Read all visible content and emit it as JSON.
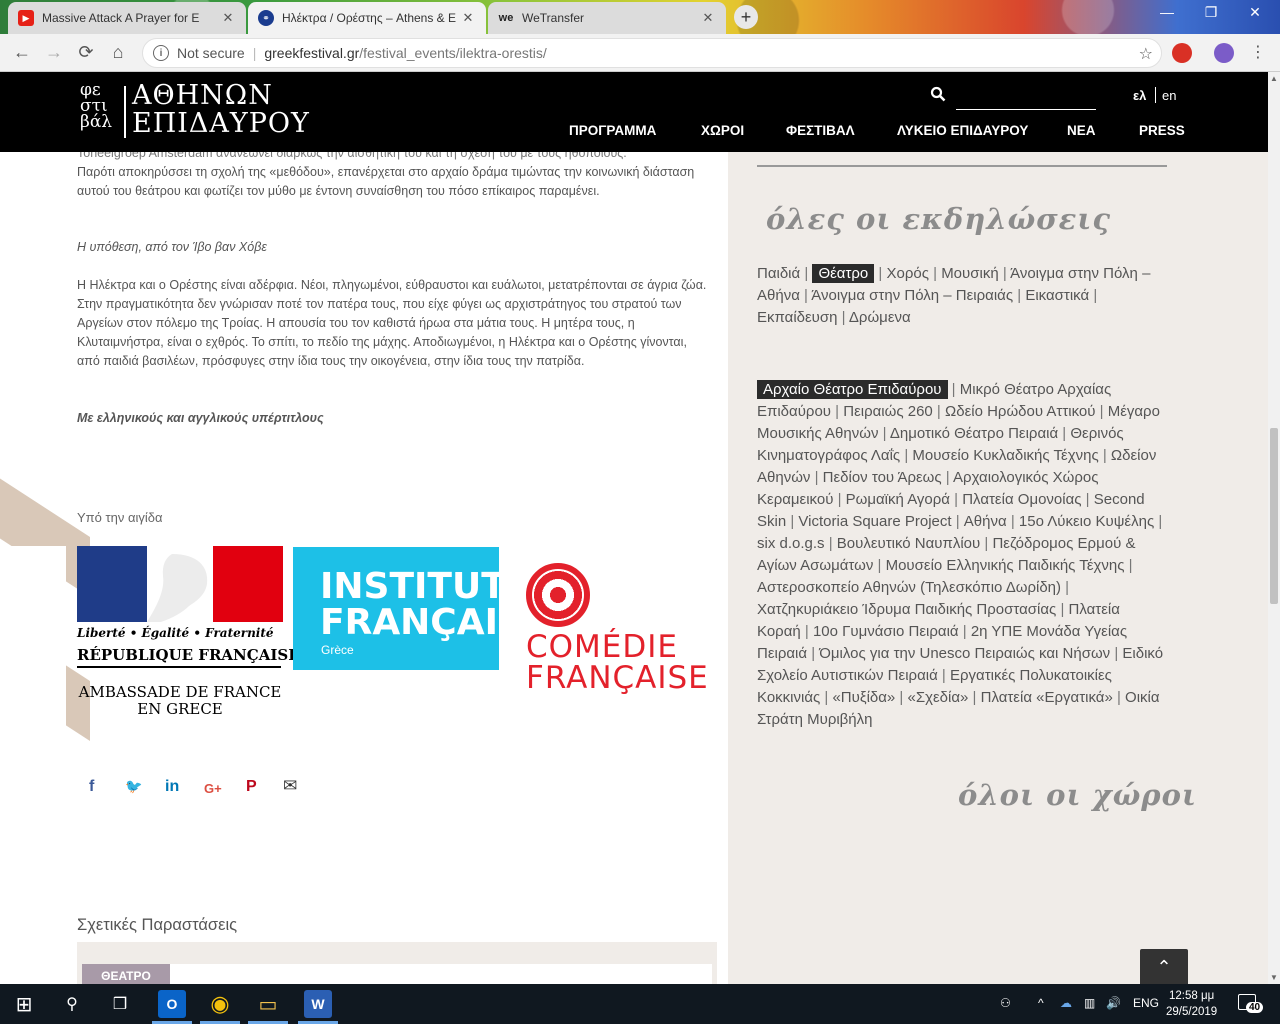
{
  "browser": {
    "tabs": [
      {
        "title": "Massive Attack A Prayer for E",
        "fav_color": "#e62117",
        "fav_glyph": "▶",
        "close": "✕"
      },
      {
        "title": "Ηλέκτρα / Ορέστης – Athens & E",
        "fav_color": "#1a3c8f",
        "fav_glyph": "⚭",
        "close": "✕"
      },
      {
        "title": "WeTransfer",
        "fav_color": "#222222",
        "fav_glyph": "we",
        "close": "✕"
      }
    ],
    "new_tab": "+",
    "window": {
      "minimize": "—",
      "restore": "❐",
      "close": "✕"
    },
    "nav": {
      "back": "←",
      "forward": "→",
      "reload": "⟳",
      "home": "⌂"
    },
    "address": {
      "security": "Not secure",
      "separator": "|",
      "domain": "greekfestival.gr",
      "path": "/festival_events/ilektra-orestis/"
    },
    "bookmark": "☆"
  },
  "header": {
    "logo_small": [
      "φε",
      "στι",
      "βάλ"
    ],
    "logo_big": [
      "ΑΘΗΝΩΝ",
      "ΕΠΙΔΑΥΡΟΥ"
    ],
    "search_icon": "🔍",
    "lang_el": "ελ",
    "lang_en": "en",
    "menu": [
      "ΠΡΟΓΡΑΜΜΑ",
      "ΧΩΡΟΙ",
      "ΦΕΣΤΙΒΑΛ",
      "ΛΥΚΕΙΟ ΕΠΙΔΑΥΡΟΥ",
      "ΝΕΑ",
      "PRESS"
    ]
  },
  "article": {
    "cut_line": "Toneelgroep Amsterdam ανανεώνει διαρκώς την αισθητική του και τη σχέση του με τους ηθοποιούς.",
    "para1": "Παρότι αποκηρύσσει τη σχολή της «μεθόδου», επανέρχεται στο αρχαίο δράμα τιμώντας την κοινωνική διάσταση αυτού του θεάτρου και φωτίζει τον μύθο με έντονη συναίσθηση του πόσο επίκαιρος παραμένει.",
    "plot_heading": "Η υπόθεση, από τον Ίβο βαν Χόβε",
    "para2": "Η Ηλέκτρα και ο Ορέστης είναι αδέρφια. Νέοι, πληγωμένοι, εύθραυστοι και ευάλωτοι, μετατρέπονται σε άγρια ζώα. Στην πραγματικότητα δεν γνώρισαν ποτέ τον πατέρα τους, που είχε φύγει ως αρχιστράτηγος του στρατού των Αργείων στον πόλεμο της Τροίας. Η απουσία του τον καθιστά ήρωα στα μάτια τους. Η μητέρα τους, η Κλυταιμνήστρα, είναι ο εχθρός. Το σπίτι, το πεδίο της μάχης. Αποδιωγμένοι, η Ηλέκτρα και ο Ορέστης γίνονται, από παιδιά βασιλέων, πρόσφυγες στην ίδια τους την οικογένεια, στην ίδια τους την πατρίδα.",
    "subtitles": "Με ελληνικούς και αγγλικούς υπέρτιτλους",
    "under_auspices": "Υπό την αιγίδα",
    "rf_motto": "Liberté • Égalité • Fraternité",
    "rf_name": "RÉPUBLIQUE FRANÇAISE",
    "rf_embassy_1": "AMBASSADE DE FRANCE",
    "rf_embassy_2": "EN GRECE",
    "if_line1": "INSTITUT",
    "if_line2": "FRANÇAIS",
    "if_line3": "Grèce",
    "cf_line1": "COMÉDIE",
    "cf_line2": "FRANÇAISE",
    "share": [
      {
        "name": "facebook-icon",
        "glyph": "f",
        "color": "#3b5998"
      },
      {
        "name": "twitter-icon",
        "glyph": "🐦",
        "color": "#55acee"
      },
      {
        "name": "linkedin-icon",
        "glyph": "in",
        "color": "#0077b5"
      },
      {
        "name": "google-plus-icon",
        "glyph": "G+",
        "color": "#dc4e41"
      },
      {
        "name": "pinterest-icon",
        "glyph": "P",
        "color": "#bd081c"
      },
      {
        "name": "email-icon",
        "glyph": "✉",
        "color": "#333333"
      }
    ],
    "related_title": "Σχετικές Παραστάσεις",
    "related_badge": "ΘΕΑΤΡΟ"
  },
  "sidebar": {
    "events_heading": "όλες οι εκδηλώσεις",
    "categories": [
      "Παιδιά",
      "Θέατρο",
      "Χορός",
      "Μουσική",
      "Άνοιγμα στην Πόλη – Αθήνα",
      "Άνοιγμα στην Πόλη – Πειραιάς",
      "Εικαστικά",
      "Εκπαίδευση",
      "Δρώμενα"
    ],
    "selected_category": "Θέατρο",
    "venues": [
      "Αρχαίο Θέατρο Επιδαύρου",
      "Μικρό Θέατρο Αρχαίας Επιδαύρου",
      "Πειραιώς 260",
      "Ωδείο Ηρώδου Αττικού",
      "Μέγαρο Μουσικής Αθηνών",
      "Δημοτικό Θέατρο Πειραιά",
      "Θερινός Κινηματογράφος Λαΐς",
      "Μουσείο Κυκλαδικής Τέχνης",
      "Ωδείον Αθηνών",
      "Πεδίον του Άρεως",
      "Αρχαιολογικός Χώρος Κεραμεικού",
      "Ρωμαϊκή Αγορά",
      "Πλατεία Ομονοίας",
      "Second Skin",
      "Victoria Square Project",
      "Αθήνα",
      "15ο Λύκειο Κυψέλης",
      "six d.o.g.s",
      "Βουλευτικό Ναυπλίου",
      "Πεζόδρομος Ερμού & Αγίων Ασωμάτων",
      "Μουσείο Ελληνικής Παιδικής Τέχνης",
      "Αστεροσκοπείο Αθηνών (Τηλεσκόπιο Δωρίδη)",
      "Χατζηκυριάκειο Ίδρυμα Παιδικής Προστασίας",
      "Πλατεία Κοραή",
      "10ο Γυμνάσιο Πειραιά",
      "2η ΥΠΕ Μονάδα Υγείας Πειραιά",
      "Όμιλος για την Unesco Πειραιώς και Νήσων",
      "Ειδικό Σχολείο Αυτιστικών Πειραιά",
      "Εργατικές Πολυκατοικίες Κοκκινιάς",
      "«Πυξίδα»",
      "«Σχεδία»",
      "Πλατεία «Εργατικά»",
      "Οικία Στράτη Μυριβήλη"
    ],
    "selected_venue": "Αρχαίο Θέατρο Επιδαύρου",
    "venues_heading": "όλοι οι χώροι",
    "to_top": "⌃"
  },
  "taskbar": {
    "icons": [
      {
        "name": "windows-start-icon",
        "glyph": "⊞"
      },
      {
        "name": "search-icon",
        "glyph": "⚲"
      },
      {
        "name": "task-view-icon",
        "glyph": "❒"
      },
      {
        "name": "outlook-icon",
        "glyph": "O"
      },
      {
        "name": "chrome-icon",
        "glyph": "◉"
      },
      {
        "name": "file-explorer-icon",
        "glyph": "▭"
      },
      {
        "name": "word-icon",
        "glyph": "W"
      }
    ],
    "tray": {
      "people": "⚇",
      "chevron": "^",
      "onedrive": "☁",
      "network": "▥",
      "volume": "🔊",
      "lang": "ENG"
    },
    "time": "12:58 μμ",
    "date": "29/5/2019",
    "notifications": "40"
  }
}
